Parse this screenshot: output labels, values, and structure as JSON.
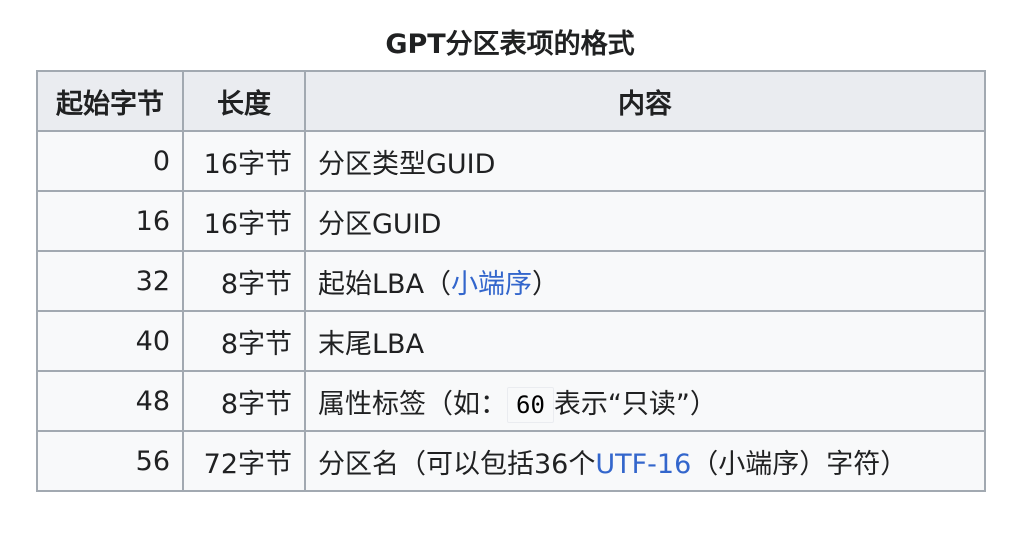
{
  "caption": "GPT分区表项的格式",
  "headers": {
    "start": "起始字节",
    "length": "长度",
    "content": "内容"
  },
  "rows": [
    {
      "start": "0",
      "length": "16字节",
      "content": "分区类型GUID"
    },
    {
      "start": "16",
      "length": "16字节",
      "content": "分区GUID"
    },
    {
      "start": "32",
      "length": "8字节",
      "content_pre": "起始LBA（",
      "content_link": "小端序",
      "content_post": "）"
    },
    {
      "start": "40",
      "length": "8字节",
      "content": "末尾LBA"
    },
    {
      "start": "48",
      "length": "8字节",
      "content_pre": "属性标签（如：",
      "content_code": "60",
      "content_post": "表示“只读”）"
    },
    {
      "start": "56",
      "length": "72字节",
      "content_pre": "分区名（可以包括36个",
      "content_link": "UTF-16",
      "content_post": "（小端序）字符）"
    }
  ],
  "colors": {
    "header_bg": "#eaecf0",
    "cell_bg": "#f8f9fa",
    "border": "#a2a9b1",
    "link": "#3366cc",
    "text": "#202122"
  }
}
